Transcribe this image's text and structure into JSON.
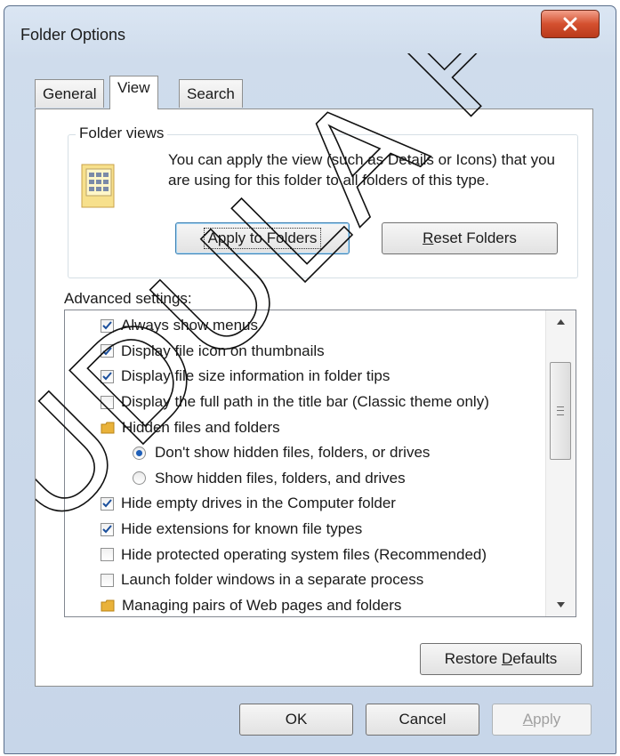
{
  "window": {
    "title": "Folder Options",
    "close_label": "x"
  },
  "tabs": [
    {
      "label": "General",
      "active": false
    },
    {
      "label": "View",
      "active": true
    },
    {
      "label": "Search",
      "active": false
    }
  ],
  "folder_views": {
    "legend": "Folder views",
    "description": "You can apply the view (such as Details or Icons) that you are using for this folder to all folders of this type.",
    "apply_label": "Apply to Folders",
    "reset_label": "Reset Folders",
    "reset_accel": "R",
    "reset_rest": "eset Folders"
  },
  "advanced": {
    "label": "Advanced settings:",
    "items": [
      {
        "type": "checkbox",
        "checked": true,
        "label": "Always show menus"
      },
      {
        "type": "checkbox",
        "checked": true,
        "label": "Display file icon on thumbnails"
      },
      {
        "type": "checkbox",
        "checked": true,
        "label": "Display file size information in folder tips"
      },
      {
        "type": "checkbox",
        "checked": false,
        "label": "Display the full path in the title bar (Classic theme only)"
      },
      {
        "type": "folder",
        "label": "Hidden files and folders"
      },
      {
        "type": "radio",
        "checked": true,
        "label": "Don't show hidden files, folders, or drives"
      },
      {
        "type": "radio",
        "checked": false,
        "label": "Show hidden files, folders, and drives"
      },
      {
        "type": "checkbox",
        "checked": true,
        "label": "Hide empty drives in the Computer folder"
      },
      {
        "type": "checkbox",
        "checked": true,
        "label": "Hide extensions for known file types"
      },
      {
        "type": "checkbox",
        "checked": false,
        "label": "Hide protected operating system files (Recommended)"
      },
      {
        "type": "checkbox",
        "checked": false,
        "label": "Launch folder windows in a separate process"
      },
      {
        "type": "folder",
        "label": "Managing pairs of Web pages and folders"
      }
    ]
  },
  "restore": {
    "pre": "Restore ",
    "accel": "D",
    "post": "efaults"
  },
  "footer": {
    "ok": "OK",
    "cancel": "Cancel",
    "apply_accel": "A",
    "apply_rest": "pply"
  },
  "watermark": {
    "text": "UDULA PR"
  },
  "colors": {
    "accent": "#1f5fb8",
    "close": "#d4502f",
    "folder": "#e9b23a"
  }
}
